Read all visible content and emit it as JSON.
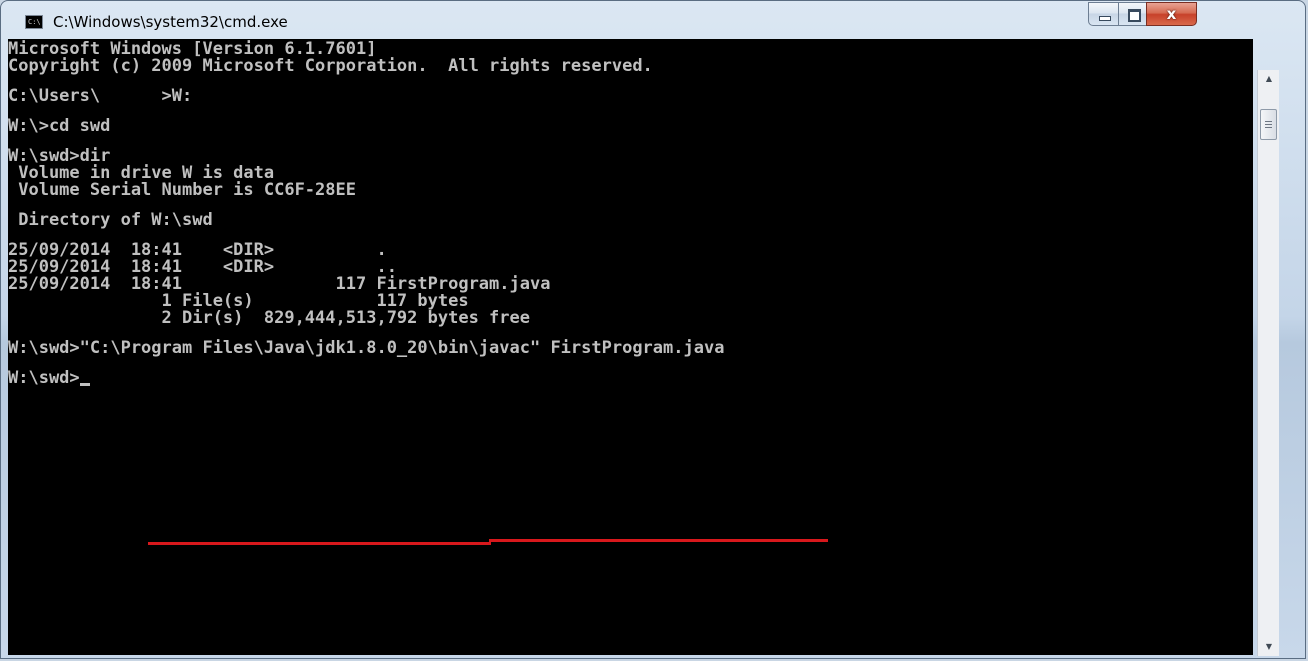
{
  "window": {
    "title": "C:\\Windows\\system32\\cmd.exe",
    "icon": "cmd-icon",
    "icon_text": "C:\\"
  },
  "controls": {
    "minimize_icon": "minimize-icon",
    "maximize_icon": "maximize-icon",
    "close_icon": "close-icon",
    "close_glyph": "x"
  },
  "console": {
    "lines": [
      "Microsoft Windows [Version 6.1.7601]",
      "Copyright (c) 2009 Microsoft Corporation.  All rights reserved.",
      "",
      "C:\\Users\\      >W:",
      "",
      "W:\\>cd swd",
      "",
      "W:\\swd>dir",
      " Volume in drive W is data",
      " Volume Serial Number is CC6F-28EE",
      "",
      " Directory of W:\\swd",
      "",
      "25/09/2014  18:41    <DIR>          .",
      "25/09/2014  18:41    <DIR>          ..",
      "25/09/2014  18:41               117 FirstProgram.java",
      "               1 File(s)            117 bytes",
      "               2 Dir(s)  829,444,513,792 bytes free",
      "",
      "W:\\swd>\"C:\\Program Files\\Java\\jdk1.8.0_20\\bin\\javac\" FirstProgram.java",
      "",
      "W:\\swd>"
    ],
    "text_color": "#c0c0c0",
    "background_color": "#000000"
  },
  "annotation": {
    "color": "#d8181c",
    "description_line": 19
  },
  "scrollbar": {
    "up_icon": "scroll-up-arrow-icon",
    "down_icon": "scroll-down-arrow-icon"
  }
}
